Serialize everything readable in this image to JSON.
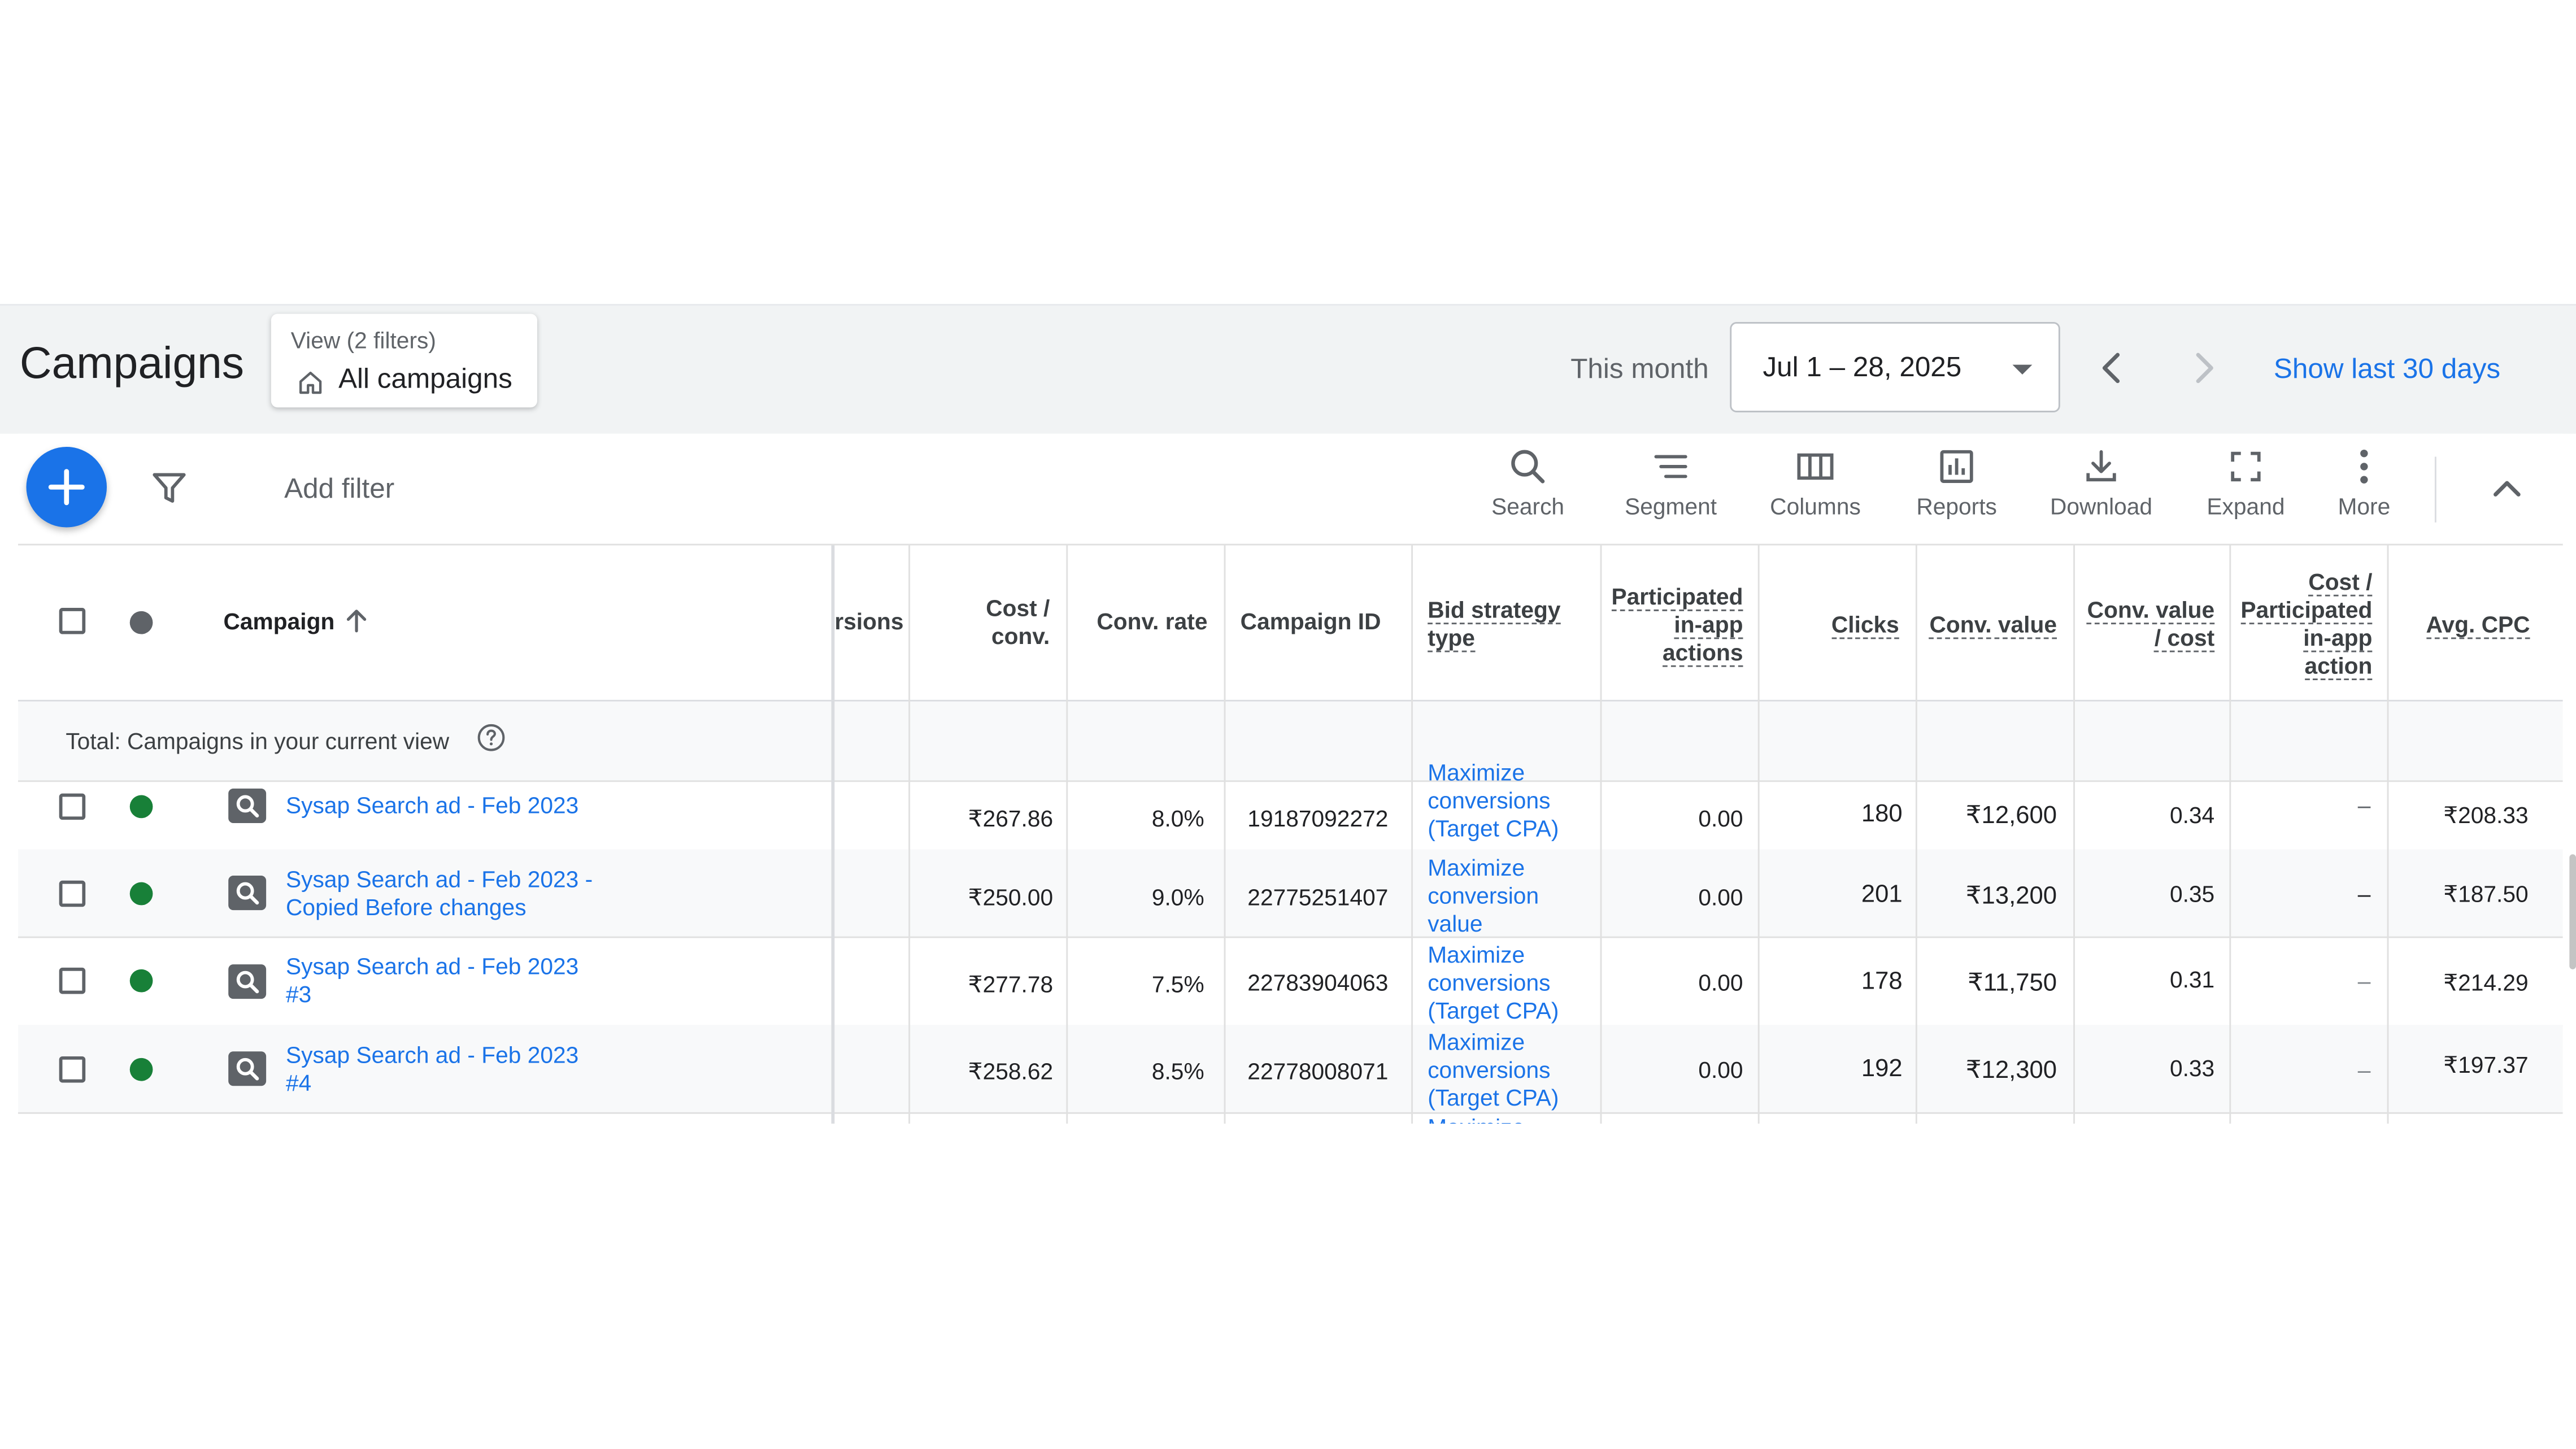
{
  "header": {
    "title": "Campaigns",
    "view_label": "View (2 filters)",
    "view_value": "All campaigns",
    "date_label": "This month",
    "date_range": "Jul 1 – 28, 2025",
    "show_last": "Show last 30 days"
  },
  "toolbar": {
    "add_filter": "Add filter",
    "search": "Search",
    "segment": "Segment",
    "columns": "Columns",
    "reports": "Reports",
    "download": "Download",
    "expand": "Expand",
    "more": "More"
  },
  "table": {
    "headers": {
      "campaign": "Campaign",
      "conversions_partial": "rsions",
      "cost_conv_1": "Cost /",
      "cost_conv_2": "conv.",
      "conv_rate": "Conv. rate",
      "campaign_id": "Campaign ID",
      "bid_strategy_1": "Bid strategy",
      "bid_strategy_2": "type",
      "participated_1": "Participated",
      "participated_2": "in-app",
      "participated_3": "actions",
      "clicks": "Clicks",
      "conv_value": "Conv. value",
      "conv_value_cost_1": "Conv. value",
      "conv_value_cost_2": "/ cost",
      "cost_participated_1": "Cost /",
      "cost_participated_2": "Participated",
      "cost_participated_3": "in-app",
      "cost_participated_4": "action",
      "avg_cpc": "Avg. CPC"
    },
    "total_label": "Total: Campaigns in your current view",
    "rows": [
      {
        "name_1": "Sysap Search ad -  Feb 2023",
        "name_2": "",
        "cost_conv": "₹267.86",
        "conv_rate": "8.0%",
        "campaign_id": "19187092272",
        "bid_1": "Maximize",
        "bid_2": "conversions",
        "bid_3": "(Target CPA)",
        "participated": "0.00",
        "clicks": "180",
        "conv_value": "₹12,600",
        "conv_value_cost": "0.34",
        "cost_participated": "–",
        "avg_cpc": "₹208.33"
      },
      {
        "name_1": "Sysap Search ad -  Feb 2023 -",
        "name_2": "Copied Before changes",
        "cost_conv": "₹250.00",
        "conv_rate": "9.0%",
        "campaign_id": "22775251407",
        "bid_1": "Maximize",
        "bid_2": "conversion",
        "bid_3": "value",
        "participated": "0.00",
        "clicks": "201",
        "conv_value": "₹13,200",
        "conv_value_cost": "0.35",
        "cost_participated": "–",
        "avg_cpc": "₹187.50"
      },
      {
        "name_1": "Sysap Search ad -  Feb 2023",
        "name_2": "#3",
        "cost_conv": "₹277.78",
        "conv_rate": "7.5%",
        "campaign_id": "22783904063",
        "bid_1": "Maximize",
        "bid_2": "conversions",
        "bid_3": "(Target CPA)",
        "participated": "0.00",
        "clicks": "178",
        "conv_value": "₹11,750",
        "conv_value_cost": "0.31",
        "cost_participated": "–",
        "avg_cpc": "₹214.29"
      },
      {
        "name_1": "Sysap Search ad -  Feb 2023",
        "name_2": "#4",
        "cost_conv": "₹258.62",
        "conv_rate": "8.5%",
        "campaign_id": "22778008071",
        "bid_1": "Maximize",
        "bid_2": "conversions",
        "bid_3": "(Target CPA)",
        "participated": "0.00",
        "clicks": "192",
        "conv_value": "₹12,300",
        "conv_value_cost": "0.33",
        "cost_participated": "–",
        "avg_cpc": "₹197.37"
      }
    ]
  },
  "colors": {
    "accent": "#1a73e8",
    "status_enabled": "#188038",
    "status_header": "#5f6368"
  }
}
